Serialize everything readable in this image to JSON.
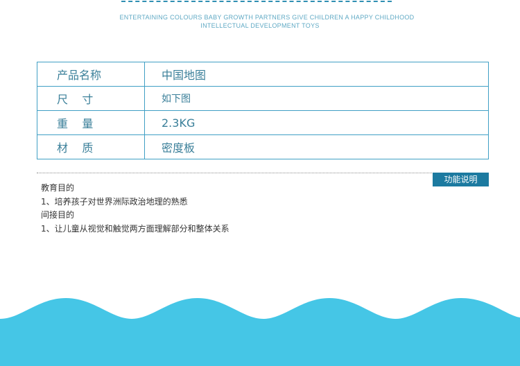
{
  "header": {
    "tagline_line1": "ENTERTAINING COLOURS BABY GROWTH PARTNERS GIVE CHILDREN A HAPPY CHILDHOOD",
    "tagline_line2": "INTELLECTUAL DEVELOPMENT TOYS"
  },
  "spec": {
    "rows": [
      {
        "label": "产品名称",
        "value": "中国地图"
      },
      {
        "label": "尺    寸",
        "value": "如下图"
      },
      {
        "label": "重    量",
        "value": "2.3KG"
      },
      {
        "label": "材    质",
        "value": "密度板"
      }
    ]
  },
  "function": {
    "button_label": "功能说明",
    "lines": [
      "教育目的",
      "1、培养孩子对世界洲际政治地理的熟悉",
      "间接目的",
      "1、让儿童从视觉和触觉两方面理解部分和整体关系"
    ]
  },
  "colors": {
    "accent": "#3f9fc4",
    "button": "#1c7aa0",
    "wave": "#45c6e6"
  }
}
